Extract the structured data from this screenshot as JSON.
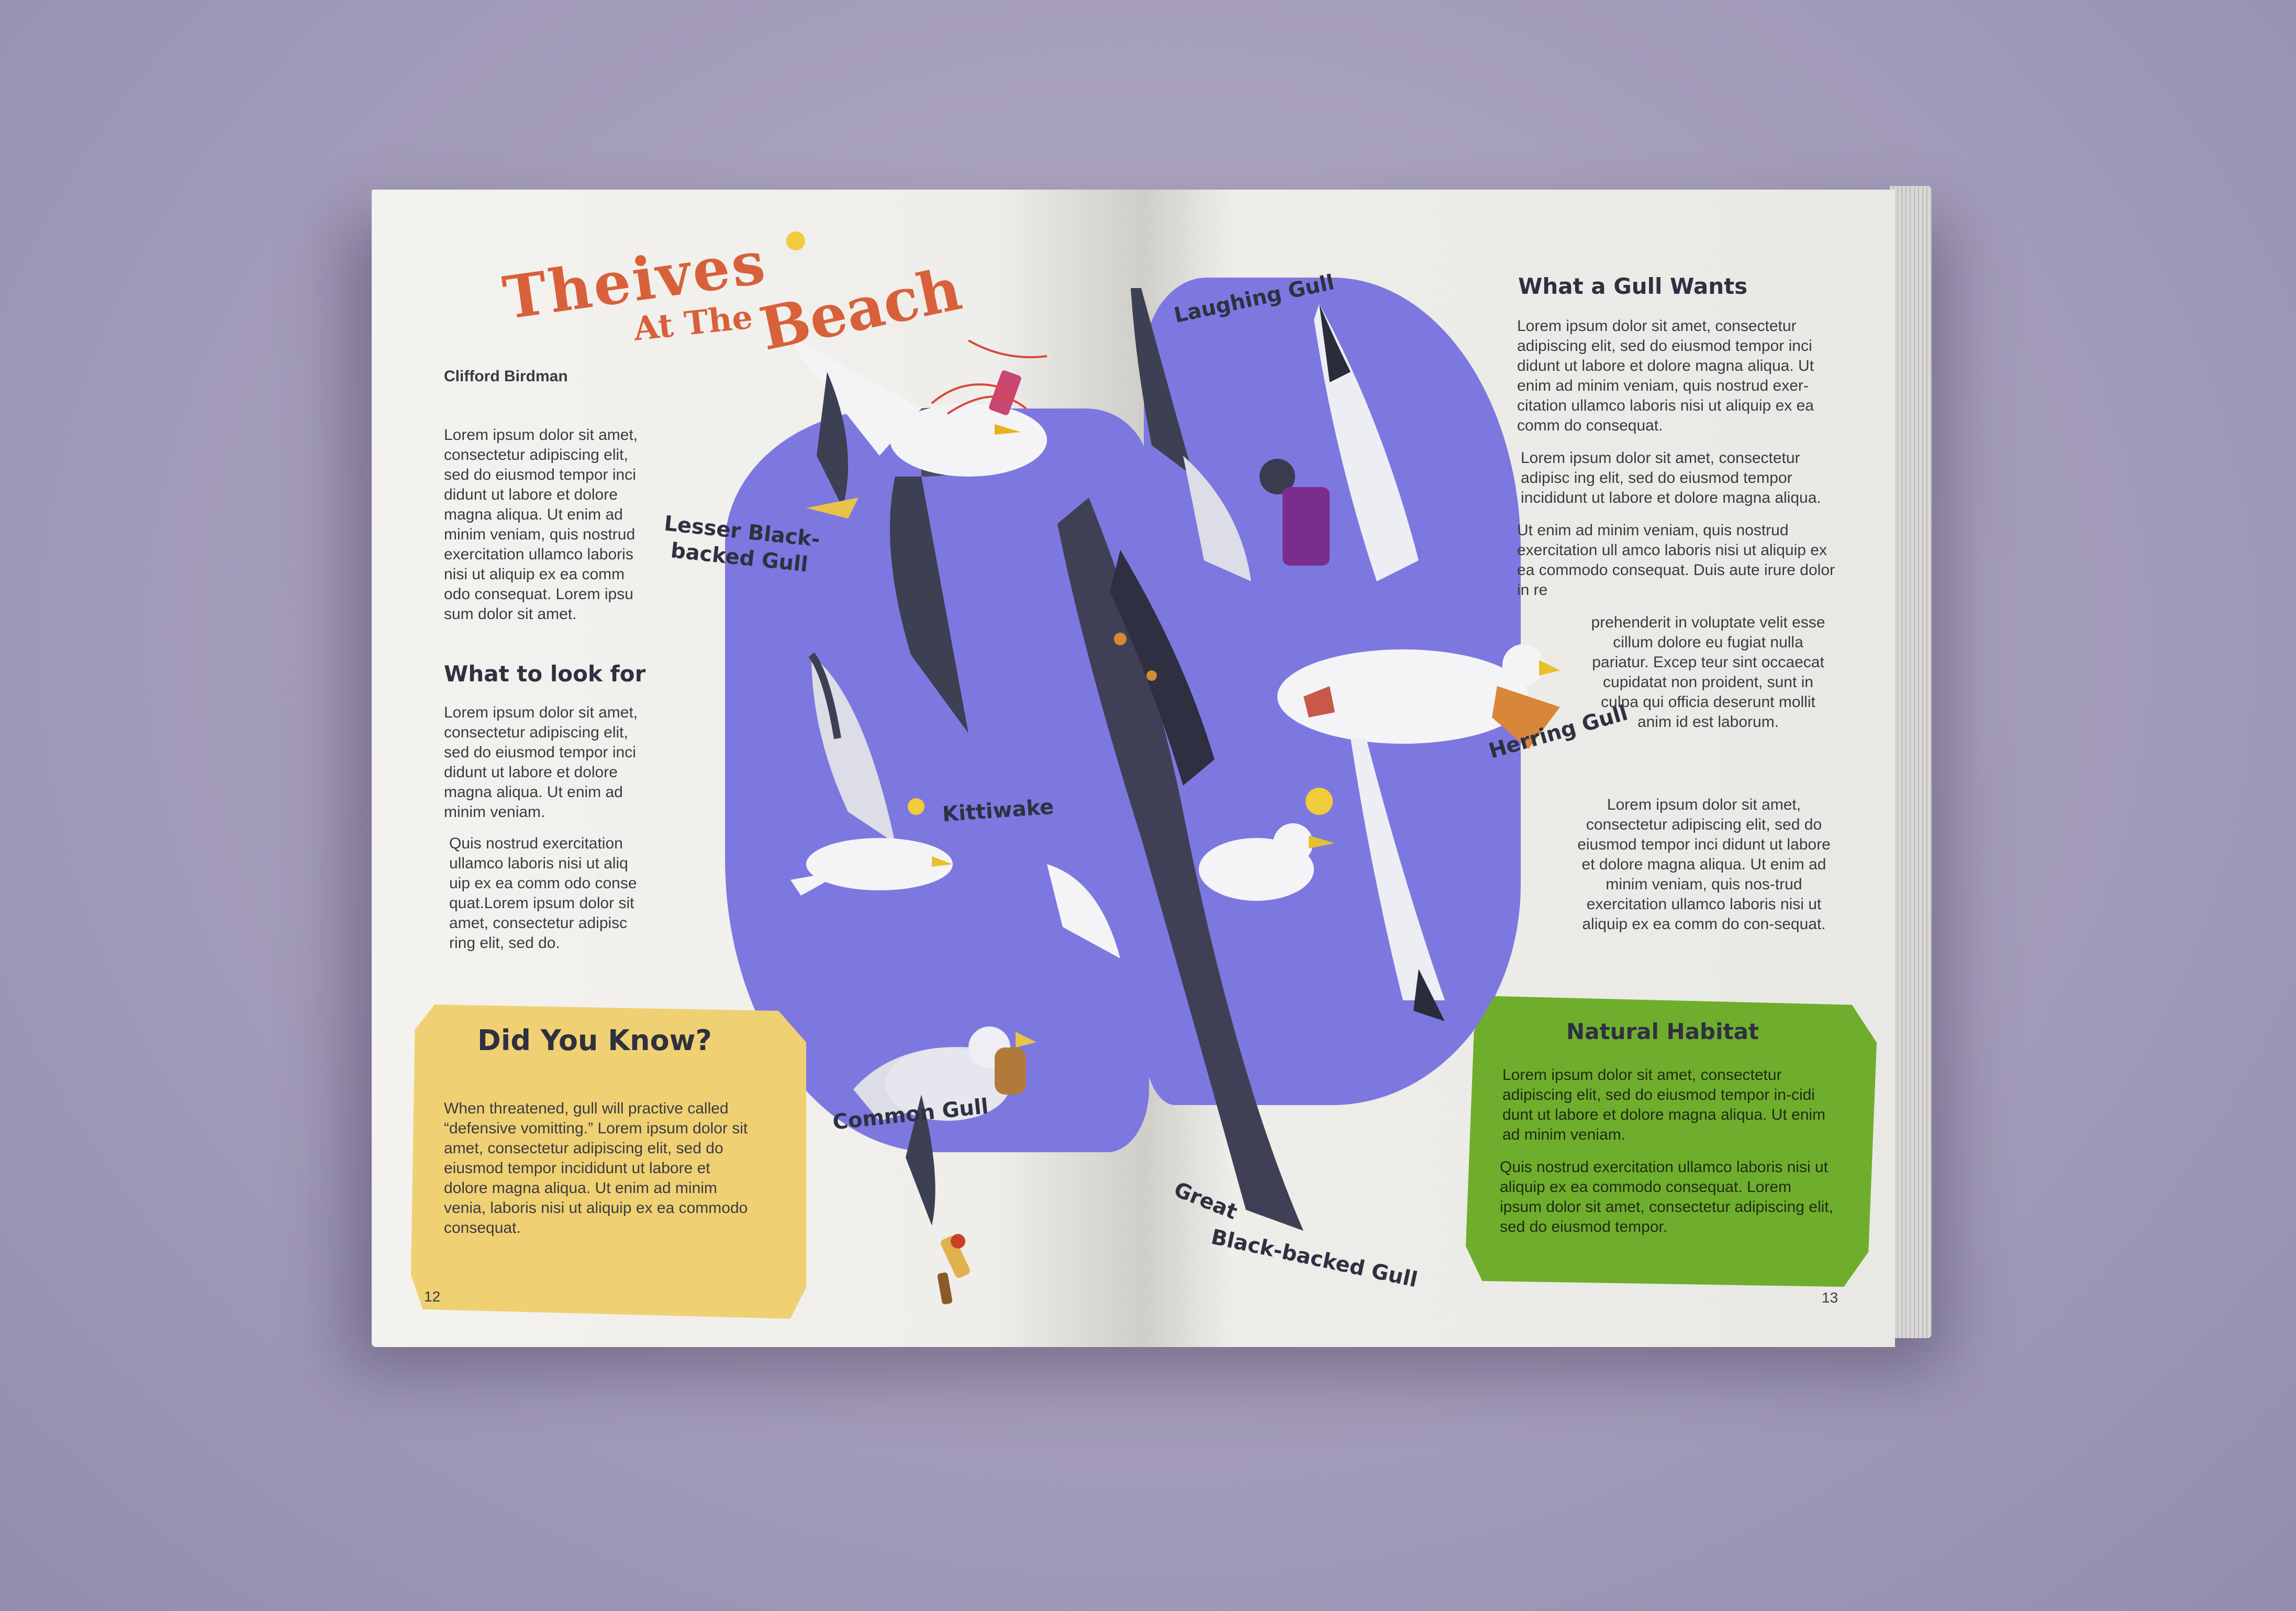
{
  "left_page": {
    "title_line1": "Theives",
    "title_line2": "At The",
    "title_line3": "Beach",
    "author": "Clifford Birdman",
    "intro": "Lorem ipsum dolor sit amet, consectetur adipiscing elit, sed do eiusmod tempor inci didunt ut labore et dolore magna aliqua. Ut enim ad minim veniam, quis nostrud exercitation ullamco laboris nisi ut aliquip ex ea comm odo consequat. Lorem ipsu sum dolor sit amet.",
    "look_heading": "What to look for",
    "look_p1": "Lorem ipsum dolor sit amet, consectetur adipiscing elit, sed do eiusmod tempor inci didunt ut labore et dolore magna aliqua. Ut enim ad minim veniam.",
    "look_p2": "Quis nostrud exercitation ullamco laboris nisi ut aliq uip ex ea comm odo conse quat.Lorem ipsum dolor sit amet, consectetur adipisc ring elit, sed do.",
    "did_you_know_heading": "Did You Know?",
    "did_you_know_text": "When threatened, gull will practive called “defensive vomitting.” Lorem ipsum dolor sit amet, consectetur adipiscing elit, sed do eiusmod tempor incididunt ut labore et dolore magna aliqua. Ut enim ad minim venia, laboris nisi ut aliquip ex ea commodo consequat.",
    "page_number": "12"
  },
  "bird_labels": {
    "lesser": "Lesser Black-backed Gull",
    "kittiwake": "Kittiwake",
    "common": "Common Gull",
    "laughing": "Laughing Gull",
    "herring": "Herring Gull",
    "great_line1": "Great",
    "great_line2": "Black-backed Gull"
  },
  "right_page": {
    "wants_heading": "What a Gull Wants",
    "wants_p1": "Lorem ipsum dolor sit amet, consectetur adipiscing elit, sed do eiusmod tempor inci didunt ut labore et dolore magna aliqua. Ut enim ad minim veniam, quis nostrud exer-citation ullamco laboris nisi ut aliquip ex ea comm do consequat.",
    "wants_p2": "Lorem ipsum dolor sit amet, consectetur adipisc ing elit, sed do eiusmod tempor incididunt ut labore et dolore magna aliqua.",
    "wants_p3": "Ut enim ad minim veniam, quis nostrud exercitation ull amco laboris nisi ut aliquip ex ea commodo consequat. Duis aute irure dolor in re",
    "wants_p4": "prehenderit in voluptate velit esse cillum dolore eu fugiat nulla pariatur. Excep teur sint occaecat cupidatat non proident, sunt in culpa qui officia deserunt mollit anim id est laborum.",
    "wants_p5": "Lorem ipsum dolor sit amet, consectetur adipiscing elit, sed do eiusmod tempor inci didunt ut labore et dolore magna aliqua. Ut enim ad minim veniam, quis nos-trud exercitation ullamco laboris nisi ut aliquip ex ea comm do con-sequat.",
    "habitat_heading": "Natural Habitat",
    "habitat_p1": "Lorem ipsum dolor sit amet, consectetur adipiscing elit, sed do eiusmod tempor in-cidi dunt ut labore et dolore magna aliqua. Ut enim ad minim veniam.",
    "habitat_p2": "Quis nostrud exercitation ullamco laboris nisi ut aliquip ex ea commodo consequat. Lorem ipsum dolor sit amet, consectetur adipiscing elit, sed do eiusmod tempor.",
    "page_number": "13"
  }
}
